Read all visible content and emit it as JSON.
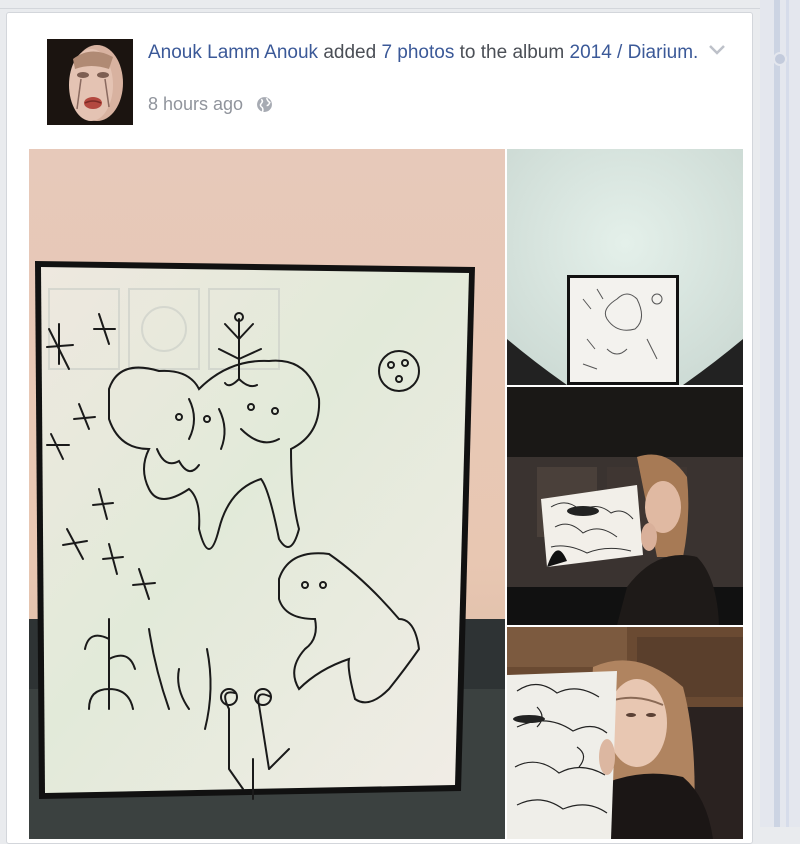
{
  "post": {
    "author": "Anouk Lamm Anouk",
    "action": "added",
    "photo_count_link": "7 photos",
    "to_album_text": "to the album",
    "album_name": "2014 / Diarium.",
    "timestamp": "8 hours ago",
    "privacy_icon": "globe-icon",
    "menu_icon": "chevron-down-icon"
  },
  "photos": [
    {
      "description": "framed line drawing of animals and plants on a white panel"
    },
    {
      "description": "small framed drawing against a pale wall"
    },
    {
      "description": "person holding a drawing in front of their face"
    },
    {
      "description": "person holding a drawing next to their face"
    }
  ],
  "colors": {
    "link": "#3b5998",
    "text": "#4b4f56",
    "meta": "#90949c",
    "card_border": "#d3d6db",
    "page_bg": "#e9ebee"
  }
}
